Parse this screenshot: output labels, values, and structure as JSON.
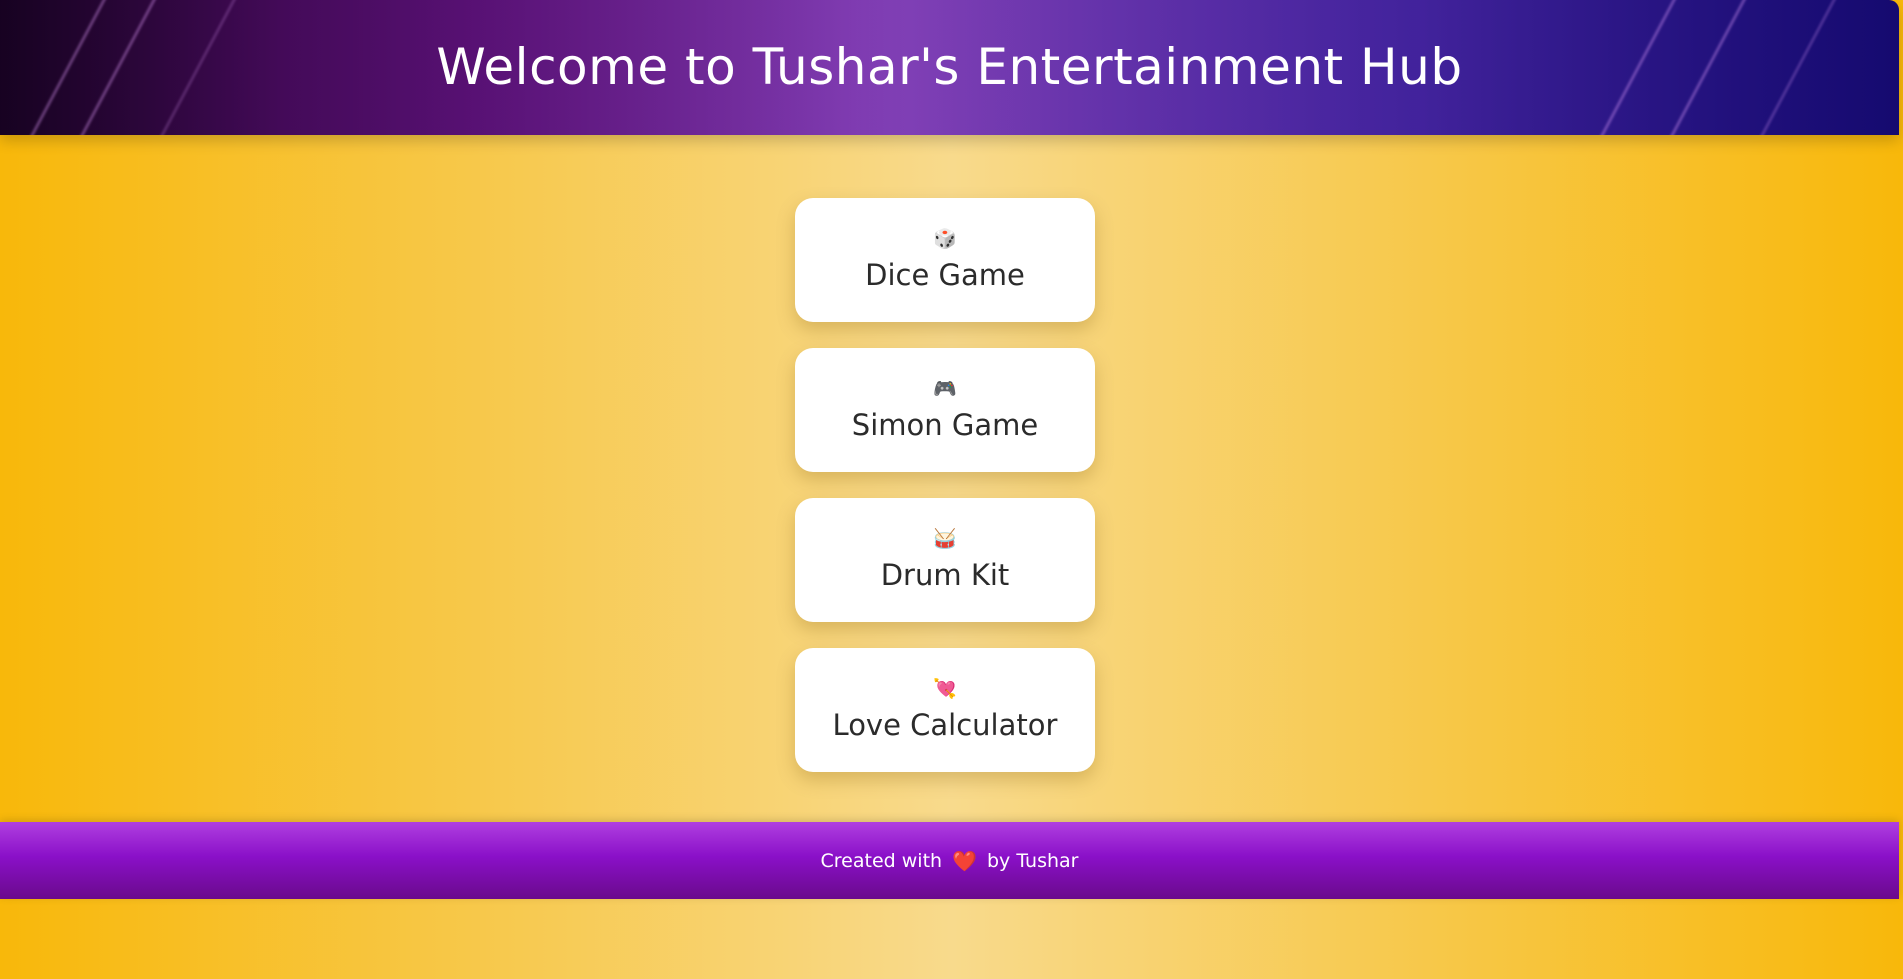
{
  "header": {
    "title": "Welcome to Tushar's Entertainment Hub"
  },
  "cards": [
    {
      "icon": "🎲",
      "icon_name": "dice-icon",
      "label": "Dice Game"
    },
    {
      "icon": "🎮",
      "icon_name": "gamepad-icon",
      "label": "Simon Game"
    },
    {
      "icon": "🥁",
      "icon_name": "drum-icon",
      "label": "Drum Kit"
    },
    {
      "icon": "💘",
      "icon_name": "heart-arrow-icon",
      "label": "Love Calculator"
    }
  ],
  "footer": {
    "prefix": "Created with",
    "heart": "❤️",
    "suffix": "by Tushar"
  },
  "colors": {
    "background_edge": "#f8b80a",
    "background_center": "#f8da8c",
    "header_purple": "#8b4bc0",
    "footer_purple": "#8a10c8",
    "card": "#ffffff"
  }
}
